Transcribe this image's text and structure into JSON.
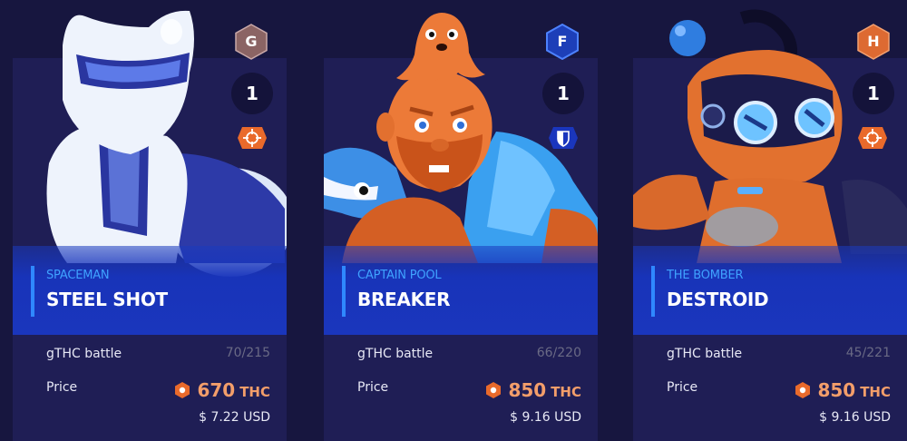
{
  "cards": [
    {
      "hero": "SPACEMAN",
      "skin": "STEEL SHOT",
      "grade": "G",
      "grade_color": "#8b6464",
      "level": "1",
      "type_icon": "crosshair-icon",
      "battle_label": "gTHC battle",
      "battle_value": "70/215",
      "price_label": "Price",
      "price_value": "670",
      "price_unit": "THC",
      "usd": "$ 7.22 USD"
    },
    {
      "hero": "CAPTAIN POOL",
      "skin": "BREAKER",
      "grade": "F",
      "grade_color": "#2457d6",
      "level": "1",
      "type_icon": "shield-icon",
      "battle_label": "gTHC battle",
      "battle_value": "66/220",
      "price_label": "Price",
      "price_value": "850",
      "price_unit": "THC",
      "usd": "$ 9.16 USD"
    },
    {
      "hero": "THE BOMBER",
      "skin": "DESTROID",
      "grade": "H",
      "grade_color": "#dd6a32",
      "level": "1",
      "type_icon": "crosshair-icon",
      "battle_label": "gTHC battle",
      "battle_value": "45/221",
      "price_label": "Price",
      "price_value": "850",
      "price_unit": "THC",
      "usd": "$ 9.16 USD"
    }
  ],
  "colors": {
    "background": "#17163f",
    "card": "#1f1e55",
    "banner": "#1a36bd",
    "accent_orange": "#e96a2b",
    "price_text": "#f39e6a",
    "hero_text": "#3fa2ff"
  }
}
